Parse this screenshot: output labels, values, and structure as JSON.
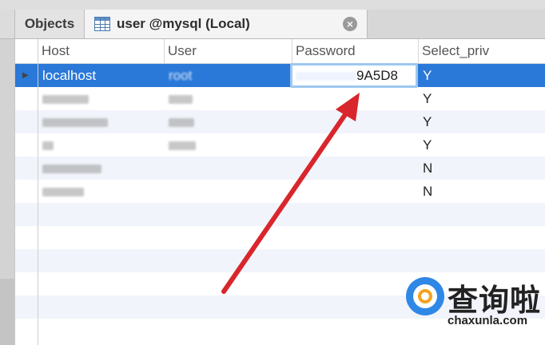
{
  "tabs": {
    "objects_label": "Objects",
    "user_label": "user @mysql (Local)"
  },
  "columns": [
    "Host",
    "User",
    "Password",
    "Select_priv"
  ],
  "rows": [
    {
      "host": "localhost",
      "user": "root",
      "password": "9A5D8",
      "select_priv": "Y",
      "selected": true
    },
    {
      "select_priv": "Y"
    },
    {
      "select_priv": "Y"
    },
    {
      "select_priv": "Y"
    },
    {
      "select_priv": "N"
    },
    {
      "select_priv": "N"
    }
  ],
  "watermark": {
    "cn": "查询啦",
    "url": "chaxunla.com"
  },
  "colors": {
    "selected_row": "#2a78d8",
    "arrow": "#d8262c",
    "edit_border": "#9ec8f0"
  },
  "icons": [
    "table-icon",
    "close-icon",
    "row-pointer-icon",
    "red-arrow-annotation"
  ]
}
